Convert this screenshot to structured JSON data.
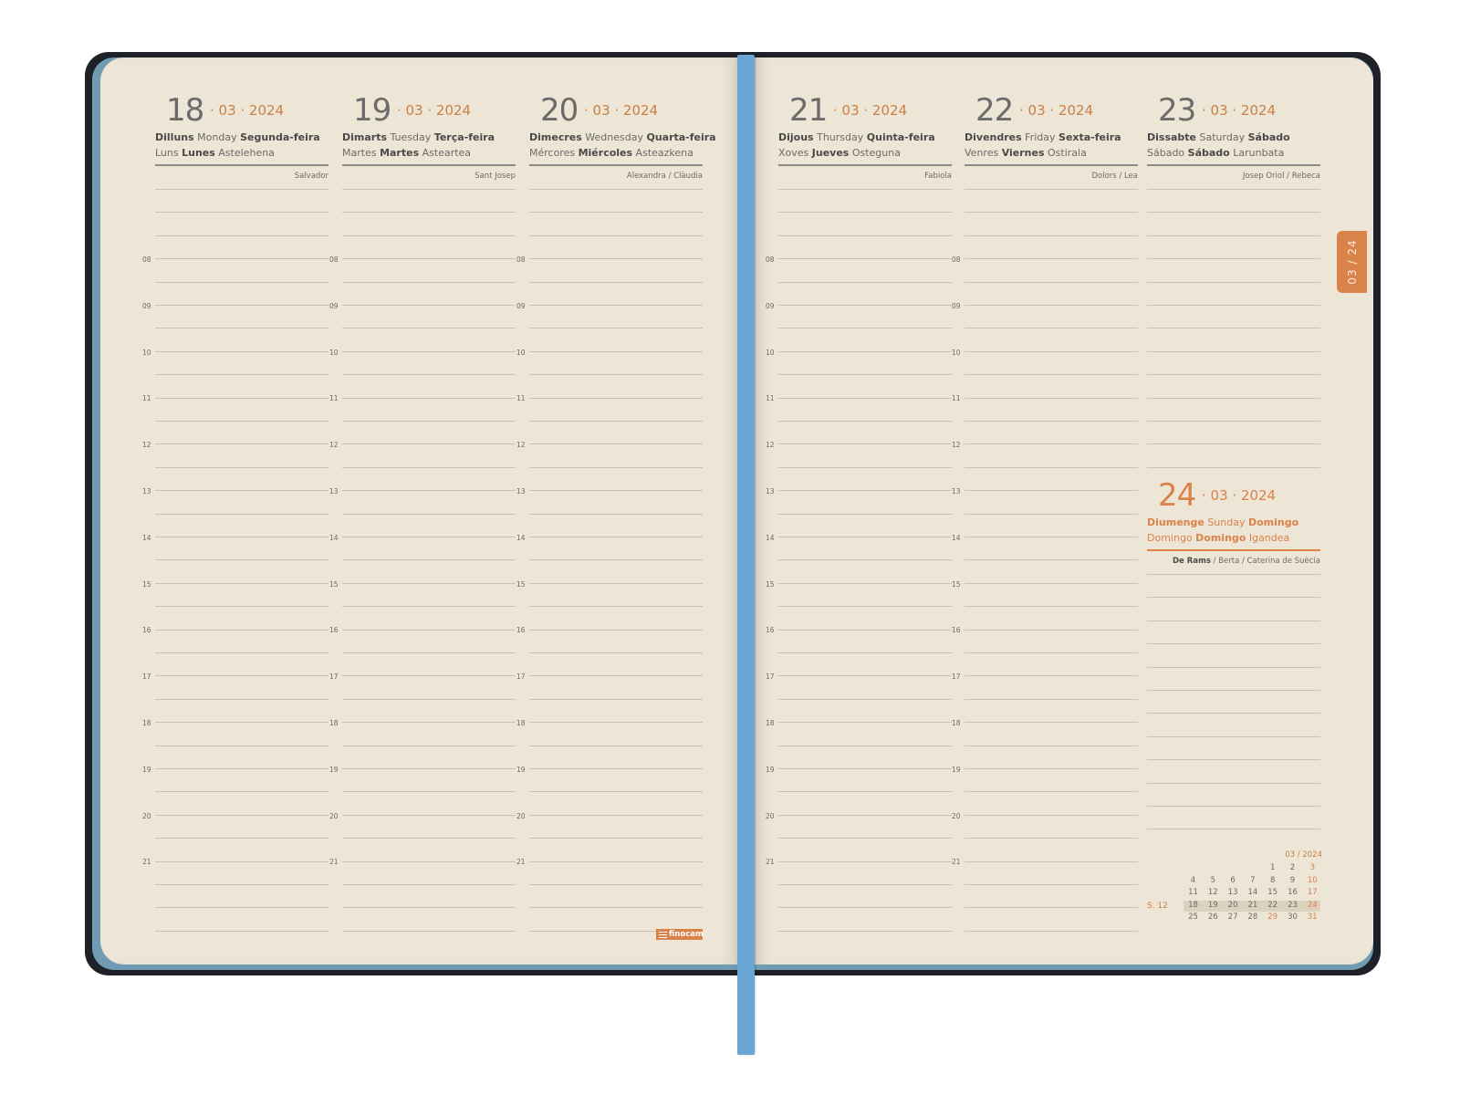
{
  "days": [
    {
      "num": "18",
      "date": "· 03 · 2024",
      "n1": [
        "Dilluns",
        " Monday ",
        "Segunda-feira"
      ],
      "n2": [
        "Luns ",
        "Lunes",
        " Astelehena"
      ],
      "saint": "Salvador"
    },
    {
      "num": "19",
      "date": "· 03 · 2024",
      "n1": [
        "Dimarts",
        " Tuesday ",
        "Terça-feira"
      ],
      "n2": [
        "Martes ",
        "Martes",
        " Asteartea"
      ],
      "saint": "Sant Josep"
    },
    {
      "num": "20",
      "date": "· 03 · 2024",
      "n1": [
        "Dimecres",
        " Wednesday ",
        "Quarta-feira"
      ],
      "n2": [
        "Mércores ",
        "Miércoles",
        " Asteazkena"
      ],
      "saint": "Alexandra / Clàudia"
    },
    {
      "num": "21",
      "date": "· 03 · 2024",
      "n1": [
        "Dijous",
        " Thursday ",
        "Quinta-feira"
      ],
      "n2": [
        "Xoves ",
        "Jueves",
        " Osteguna"
      ],
      "saint": "Fabiola"
    },
    {
      "num": "22",
      "date": "· 03 · 2024",
      "n1": [
        "Divendres",
        " Friday ",
        "Sexta-feira"
      ],
      "n2": [
        "Venres ",
        "Viernes",
        " Ostirala"
      ],
      "saint": "Dolors / Lea"
    },
    {
      "num": "23",
      "date": "· 03 · 2024",
      "n1": [
        "Dissabte",
        " Saturday ",
        "Sábado"
      ],
      "n2": [
        "Sábado ",
        "Sábado",
        " Larunbata"
      ],
      "saint": "Josep Oriol / Rebeca"
    }
  ],
  "sunday": {
    "num": "24",
    "date": "· 03 · 2024",
    "n1": [
      "Diumenge",
      " Sunday ",
      "Domingo"
    ],
    "n2": [
      "Domingo ",
      "Domingo",
      " Igandea"
    ],
    "saint_bold": "De Rams",
    "saint_rest": " / Berta / Caterina de Suècia"
  },
  "hours": [
    "08",
    "09",
    "10",
    "11",
    "12",
    "13",
    "14",
    "15",
    "16",
    "17",
    "18",
    "19",
    "20",
    "21"
  ],
  "tab_label": "03 / 24",
  "brand": "finocam",
  "mini_calendar": {
    "header": "03 / 2024",
    "week_label": "S. 12",
    "rows": [
      [
        "",
        "",
        "",
        "",
        "1",
        "2",
        "3"
      ],
      [
        "4",
        "5",
        "6",
        "7",
        "8",
        "9",
        "10"
      ],
      [
        "11",
        "12",
        "13",
        "14",
        "15",
        "16",
        "17"
      ],
      [
        "18",
        "19",
        "20",
        "21",
        "22",
        "23",
        "24"
      ],
      [
        "25",
        "26",
        "27",
        "28",
        "29",
        "30",
        "31"
      ]
    ]
  },
  "colors": {
    "accent": "#d9834b",
    "paper": "#ede5d5",
    "cover": "#1f2128",
    "ribbon": "#6aa6d4"
  }
}
